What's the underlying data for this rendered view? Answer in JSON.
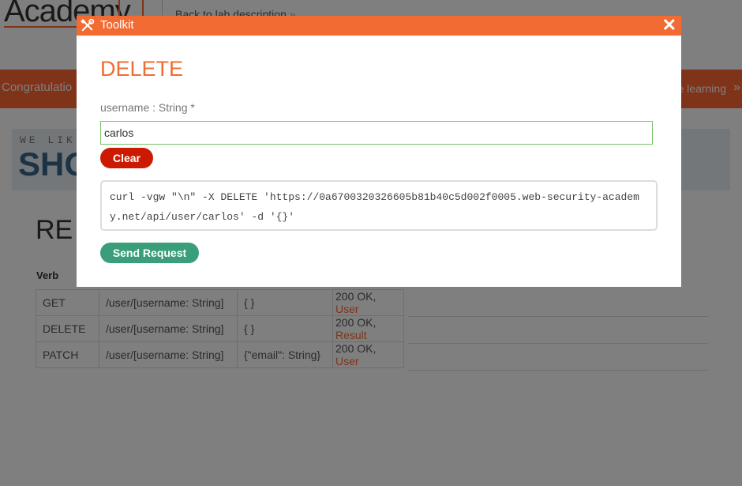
{
  "background": {
    "logo_text": "Academy",
    "back_link": "Back to lab description",
    "back_link_chevron": "»",
    "banner_left": "Congratulatio",
    "banner_right": "e learning",
    "banner_chevron": "»",
    "shop_small": "WE LIK",
    "shop_big": "SHO",
    "section_title": "RE",
    "verb_header": "Verb",
    "rows": [
      {
        "verb": "GET",
        "path": "/user/[username: String]",
        "body": "{ }",
        "status": "200 OK, ",
        "link": "User"
      },
      {
        "verb": "DELETE",
        "path": "/user/[username: String]",
        "body": "{ }",
        "status": "200 OK, ",
        "link": "Result"
      },
      {
        "verb": "PATCH",
        "path": "/user/[username: String]",
        "body": "{\"email\": String}",
        "status": "200 OK, ",
        "link": "User"
      }
    ]
  },
  "toolkit": {
    "title": "Toolkit",
    "icon": "tools-icon",
    "close_icon": "close-icon",
    "close_symbol": "✕",
    "method": "DELETE",
    "param_label": "username : String *",
    "param_value": "carlos",
    "clear_label": "Clear",
    "curl_command": "curl -vgw \"\\n\" -X DELETE 'https://0a6700320326605b81b40c5d002f0005.web-security-academy.net/api/user/carlos' -d '{}'",
    "send_label": "Send Request"
  },
  "colors": {
    "accent": "#f26b33",
    "clear_button": "#cc1a00",
    "send_button": "#3a9e7a",
    "input_border": "#7bc36b"
  }
}
